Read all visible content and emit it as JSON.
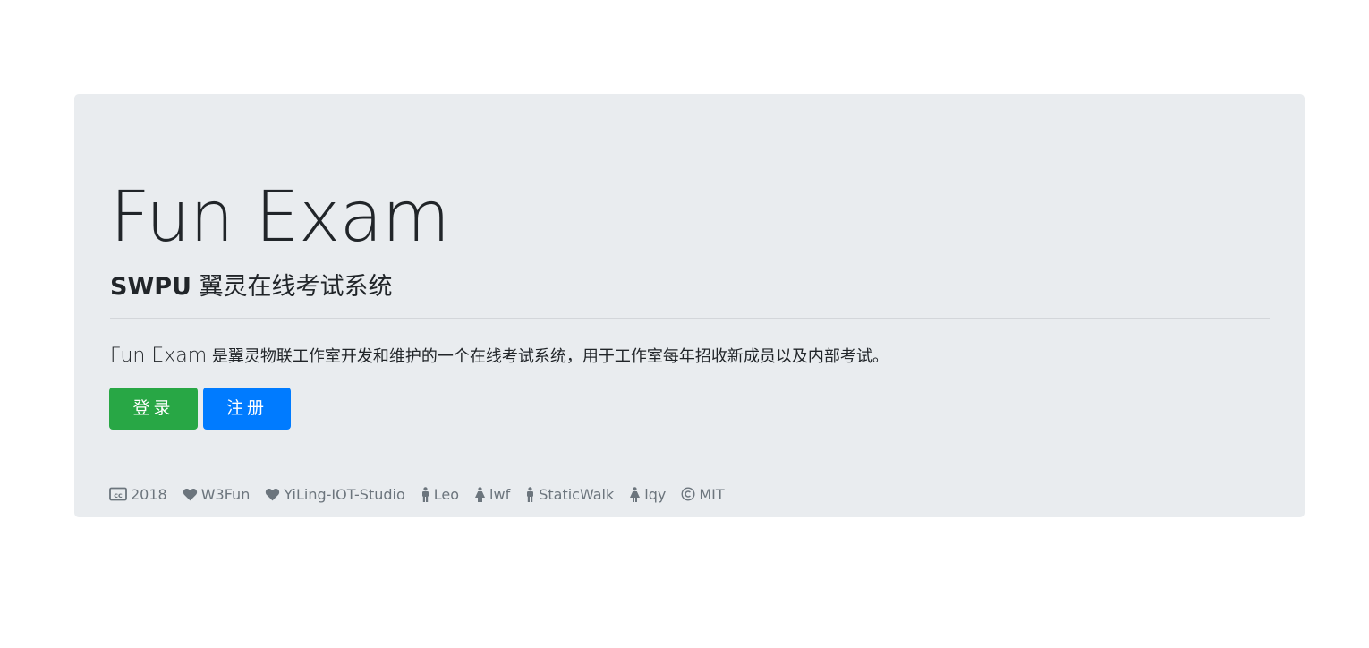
{
  "hero": {
    "title": "Fun Exam",
    "subtitle_brand": "SWPU",
    "subtitle_text": "翼灵在线考试系统",
    "lead_name": "Fun Exam",
    "lead_text": "是翼灵物联工作室开发和维护的一个在线考试系统，用于工作室每年招收新成员以及内部考试。"
  },
  "buttons": {
    "login_label": "登录",
    "register_label": "注册"
  },
  "footer": {
    "items": [
      {
        "icon": "creative-commons-icon",
        "label": "2018"
      },
      {
        "icon": "heart-icon",
        "label": "W3Fun"
      },
      {
        "icon": "heart-icon",
        "label": "YiLing-IOT-Studio"
      },
      {
        "icon": "male-icon",
        "label": "Leo"
      },
      {
        "icon": "female-icon",
        "label": "lwf"
      },
      {
        "icon": "male-icon",
        "label": "StaticWalk"
      },
      {
        "icon": "female-icon",
        "label": "lqy"
      },
      {
        "icon": "copyright-icon",
        "label": "MIT"
      }
    ]
  },
  "colors": {
    "jumbotron_bg": "#e9ecef",
    "login_button": "#28a745",
    "register_button": "#007bff",
    "muted_text": "#6c757d"
  }
}
